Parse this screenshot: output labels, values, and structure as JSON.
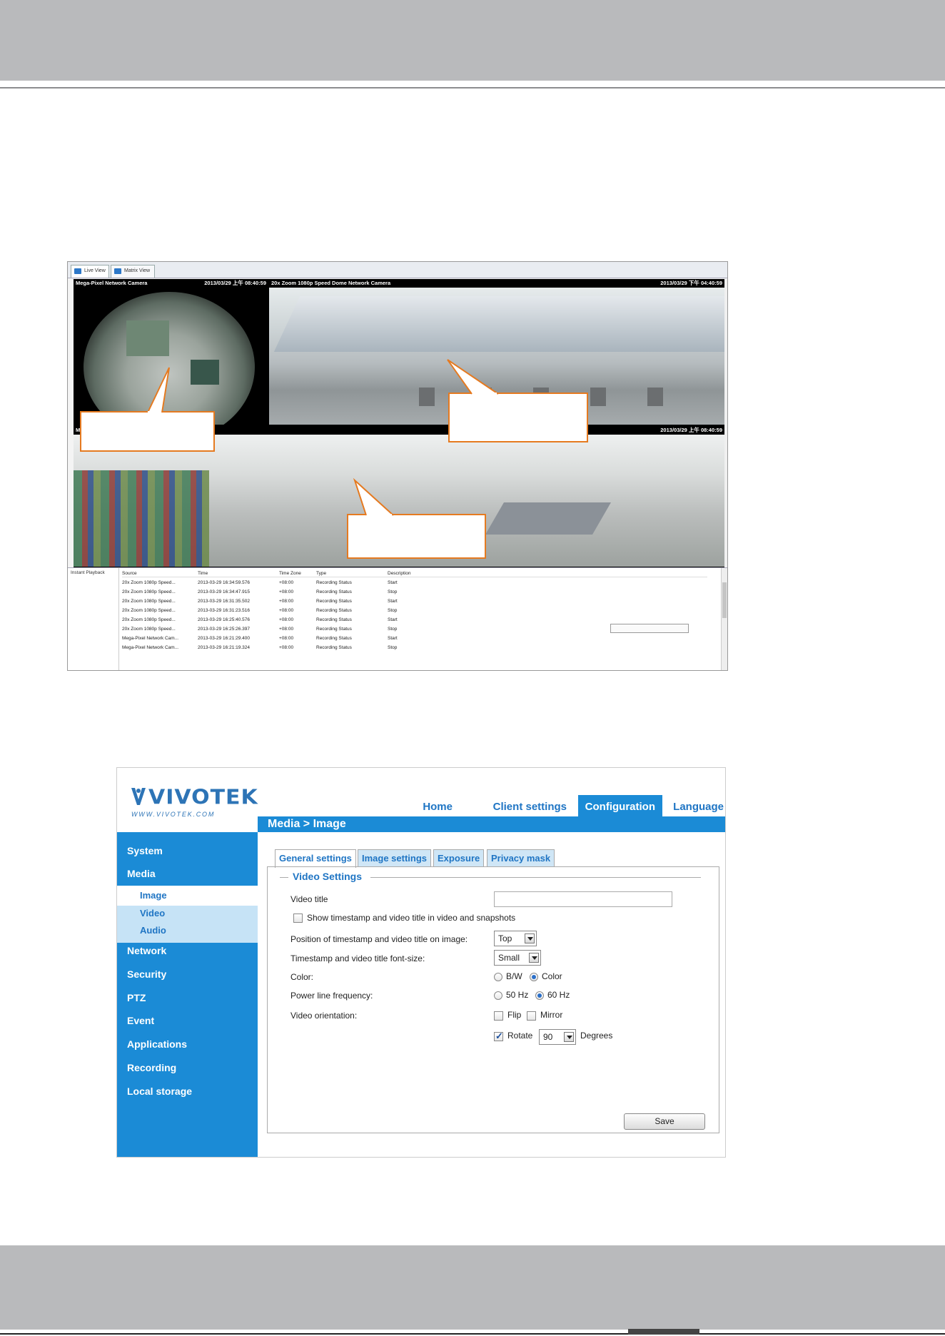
{
  "live_view": {
    "tabs": [
      {
        "label": "Live View"
      },
      {
        "label": "Matrix View"
      }
    ],
    "cameras": [
      {
        "name": "Mega-Pixel Network Camera",
        "timestamp": "2013/03/29 上午 08:40:59"
      },
      {
        "name": "20x Zoom 1080p Speed Dome Network Camera",
        "timestamp": "2013/03/29 下午 04:40:59"
      },
      {
        "name": "M",
        "timestamp": "2013/03/29 上午 08:40:59"
      }
    ],
    "side_label": "Instant Playback",
    "event_list": {
      "columns": [
        "Source",
        "Time",
        "Time Zone",
        "Type",
        "Description"
      ],
      "rows": [
        [
          "20x Zoom 1080p Speed...",
          "2013-03-29 16:34:59.576",
          "+08:00",
          "Recording Status",
          "Start"
        ],
        [
          "20x Zoom 1080p Speed...",
          "2013-03-29 16:34:47.915",
          "+08:00",
          "Recording Status",
          "Stop"
        ],
        [
          "20x Zoom 1080p Speed...",
          "2013-03-29 16:31:35.502",
          "+08:00",
          "Recording Status",
          "Start"
        ],
        [
          "20x Zoom 1080p Speed...",
          "2013-03-29 16:31:23.516",
          "+08:00",
          "Recording Status",
          "Stop"
        ],
        [
          "20x Zoom 1080p Speed...",
          "2013-03-29 16:25:40.576",
          "+08:00",
          "Recording Status",
          "Start"
        ],
        [
          "20x Zoom 1080p Speed...",
          "2013-03-29 16:25:26.397",
          "+08:00",
          "Recording Status",
          "Stop"
        ],
        [
          "Mega-Pixel Network Cam...",
          "2013-03-29 16:21:29.400",
          "+08:00",
          "Recording Status",
          "Start"
        ],
        [
          "Mega-Pixel Network Cam...",
          "2013-03-29 16:21:19.324",
          "+08:00",
          "Recording Status",
          "Stop"
        ]
      ]
    }
  },
  "config": {
    "logo": {
      "brand": "VIVOTEK",
      "url_text": "WWW.VIVOTEK.COM"
    },
    "nav": {
      "home": "Home",
      "client_settings": "Client settings",
      "configuration": "Configuration",
      "language": "Language"
    },
    "breadcrumb": "Media  > Image",
    "sidebar": {
      "system": "System",
      "media": "Media",
      "media_sub": [
        "Image",
        "Video",
        "Audio"
      ],
      "network": "Network",
      "security": "Security",
      "ptz": "PTZ",
      "event": "Event",
      "applications": "Applications",
      "recording": "Recording",
      "local_storage": "Local storage"
    },
    "tabs": [
      "General settings",
      "Image settings",
      "Exposure",
      "Privacy mask"
    ],
    "section_title": "Video Settings",
    "fields": {
      "video_title_label": "Video title",
      "video_title_value": "",
      "show_timestamp_label": "Show timestamp and video title in video and snapshots",
      "show_timestamp_checked": false,
      "position_label": "Position of timestamp and video title on image:",
      "position_value": "Top",
      "font_size_label": "Timestamp and video title font-size:",
      "font_size_value": "Small",
      "color_label": "Color:",
      "color_bw": "B/W",
      "color_color": "Color",
      "color_selected": "Color",
      "power_label": "Power line frequency:",
      "power_50": "50 Hz",
      "power_60": "60 Hz",
      "power_selected": "60 Hz",
      "orientation_label": "Video orientation:",
      "flip": "Flip",
      "mirror": "Mirror",
      "rotate": "Rotate",
      "rotate_checked": true,
      "rotate_value": "90",
      "degrees": "Degrees"
    },
    "save_label": "Save"
  },
  "colors": {
    "accent": "#1b8bd6",
    "nav_text": "#1f75c4",
    "callout_border": "#e57a20",
    "header_band": "#b9babc"
  }
}
